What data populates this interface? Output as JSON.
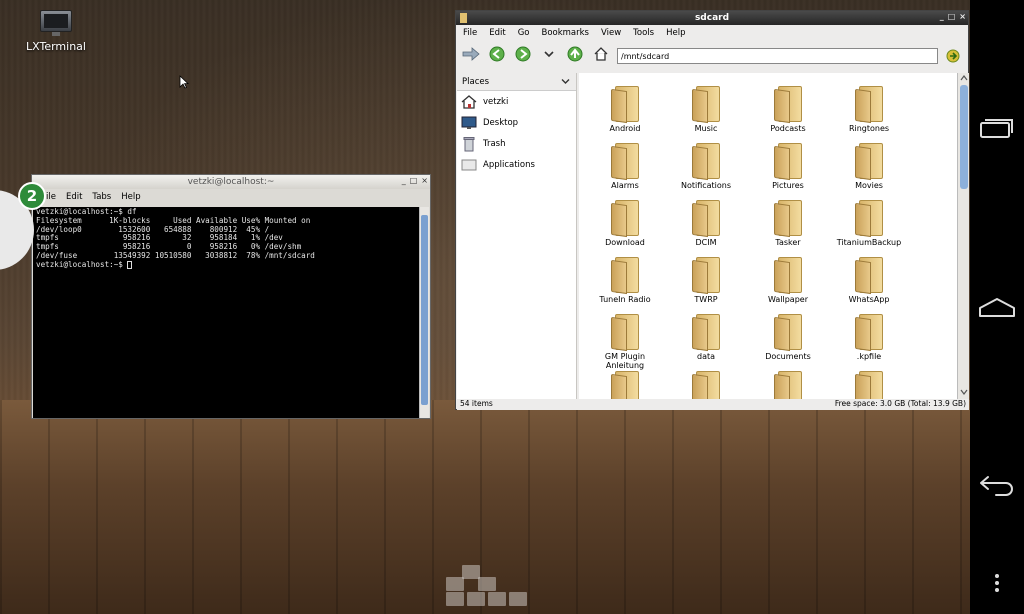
{
  "desktop": {
    "icons": [
      {
        "label": "LXTerminal",
        "icon": "monitor-icon"
      }
    ]
  },
  "badge": {
    "count": "2"
  },
  "terminal": {
    "title": "vetzki@localhost:~",
    "menu": [
      "ile",
      "Edit",
      "Tabs",
      "Help"
    ],
    "lines": [
      "vetzki@localhost:~$ df",
      "Filesystem      1K-blocks     Used Available Use% Mounted on",
      "/dev/loop0        1532600   654888    800912  45% /",
      "tmpfs              958216       32    958184   1% /dev",
      "tmpfs              958216        0    958216   0% /dev/shm",
      "/dev/fuse        13549392 10510580   3038812  78% /mnt/sdcard",
      "vetzki@localhost:~$ "
    ]
  },
  "filemanager": {
    "title": "sdcard",
    "menu": [
      "File",
      "Edit",
      "Go",
      "Bookmarks",
      "View",
      "Tools",
      "Help"
    ],
    "path": "/mnt/sdcard",
    "places_label": "Places",
    "places": [
      {
        "label": "vetzki",
        "icon": "home-icon"
      },
      {
        "label": "Desktop",
        "icon": "desktop-icon"
      },
      {
        "label": "Trash",
        "icon": "trash-icon"
      },
      {
        "label": "Applications",
        "icon": "applications-icon"
      }
    ],
    "files": [
      "Android",
      "Music",
      "Podcasts",
      "Ringtones",
      "Alarms",
      "Notifications",
      "Pictures",
      "Movies",
      "Download",
      "DCIM",
      "Tasker",
      "TitaniumBackup",
      "TuneIn Radio",
      "TWRP",
      "Wallpaper",
      "WhatsApp",
      "GM Plugin\nAnleitung",
      "data",
      "Documents",
      ".kpfile",
      "",
      "",
      "",
      ""
    ],
    "status_left": "54 items",
    "status_right": "Free space: 3.0 GB (Total: 13.9 GB)"
  },
  "colors": {
    "accent": "#2e8b3a",
    "scroll_thumb": "#8db0da",
    "folder": "#e8c98a"
  },
  "navbar": {
    "buttons": [
      {
        "name": "recent-apps",
        "icon": "recent-apps-icon"
      },
      {
        "name": "home",
        "icon": "home-outline-icon"
      },
      {
        "name": "back",
        "icon": "back-arrow-icon"
      },
      {
        "name": "menu",
        "icon": "overflow-menu-icon"
      }
    ]
  }
}
